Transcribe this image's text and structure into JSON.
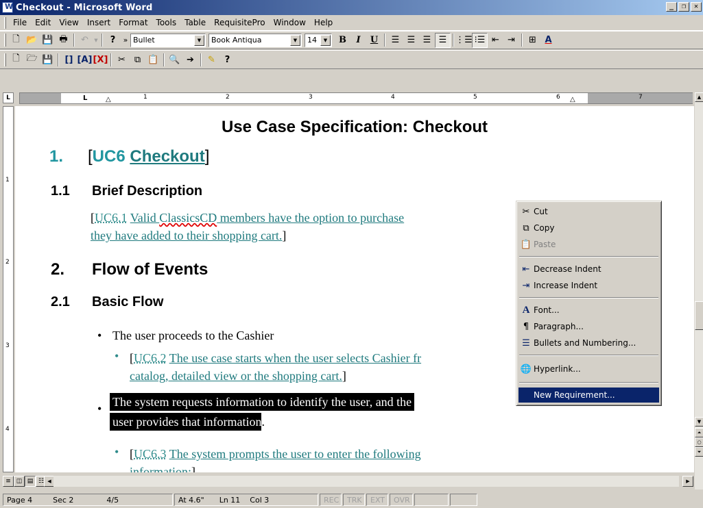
{
  "window": {
    "title": "Checkout - Microsoft Word"
  },
  "menubar": {
    "items": [
      "File",
      "Edit",
      "View",
      "Insert",
      "Format",
      "Tools",
      "Table",
      "RequisitePro",
      "Window",
      "Help"
    ]
  },
  "toolbar": {
    "style": "Bullet",
    "font": "Book Antiqua",
    "size": "14"
  },
  "document": {
    "title": "Use Case Specification: Checkout",
    "h1_num": "1.",
    "h1_uc": "UC6",
    "h1_link": "Checkout",
    "h11_num": "1.1",
    "h11_text": "Brief Description",
    "brief_uc": "UC6.1",
    "brief_line1_a": "Valid ",
    "brief_line1_b": "ClassicsCD",
    "brief_line1_c": " members have the option to purchase",
    "brief_line2": "they have added to their shopping cart.",
    "h2_num": "2.",
    "h2_text": "Flow of Events",
    "h21_num": "2.1",
    "h21_text": "Basic Flow",
    "bullet1": "The user proceeds to the Cashier",
    "sub1_uc": "UC6.2",
    "sub1_line1": "The use case starts when the user selects Cashier fr",
    "sub1_line2": "catalog, detailed view or the shopping cart.",
    "bullet2_line1": "The system requests information to identify the user, and the",
    "bullet2_line2": "user provides that information",
    "bullet2_period": ".",
    "sub2_uc": "UC6.3",
    "sub2_line1": "The system prompts the user to enter the following",
    "sub2_line2": "information:"
  },
  "context_menu": {
    "cut": "Cut",
    "copy": "Copy",
    "paste": "Paste",
    "decrease_indent": "Decrease Indent",
    "increase_indent": "Increase Indent",
    "font": "Font...",
    "paragraph": "Paragraph...",
    "bullets": "Bullets and Numbering...",
    "hyperlink": "Hyperlink...",
    "new_requirement": "New Requirement..."
  },
  "status": {
    "page": "Page 4",
    "sec": "Sec 2",
    "pages": "4/5",
    "at": "At 4.6\"",
    "ln": "Ln 11",
    "col": "Col 3",
    "rec": "REC",
    "trk": "TRK",
    "ext": "EXT",
    "ovr": "OVR"
  },
  "ruler": {
    "h": [
      "1",
      "2",
      "3",
      "4",
      "5",
      "6",
      "7"
    ],
    "v": [
      "1",
      "2",
      "3",
      "4"
    ]
  }
}
